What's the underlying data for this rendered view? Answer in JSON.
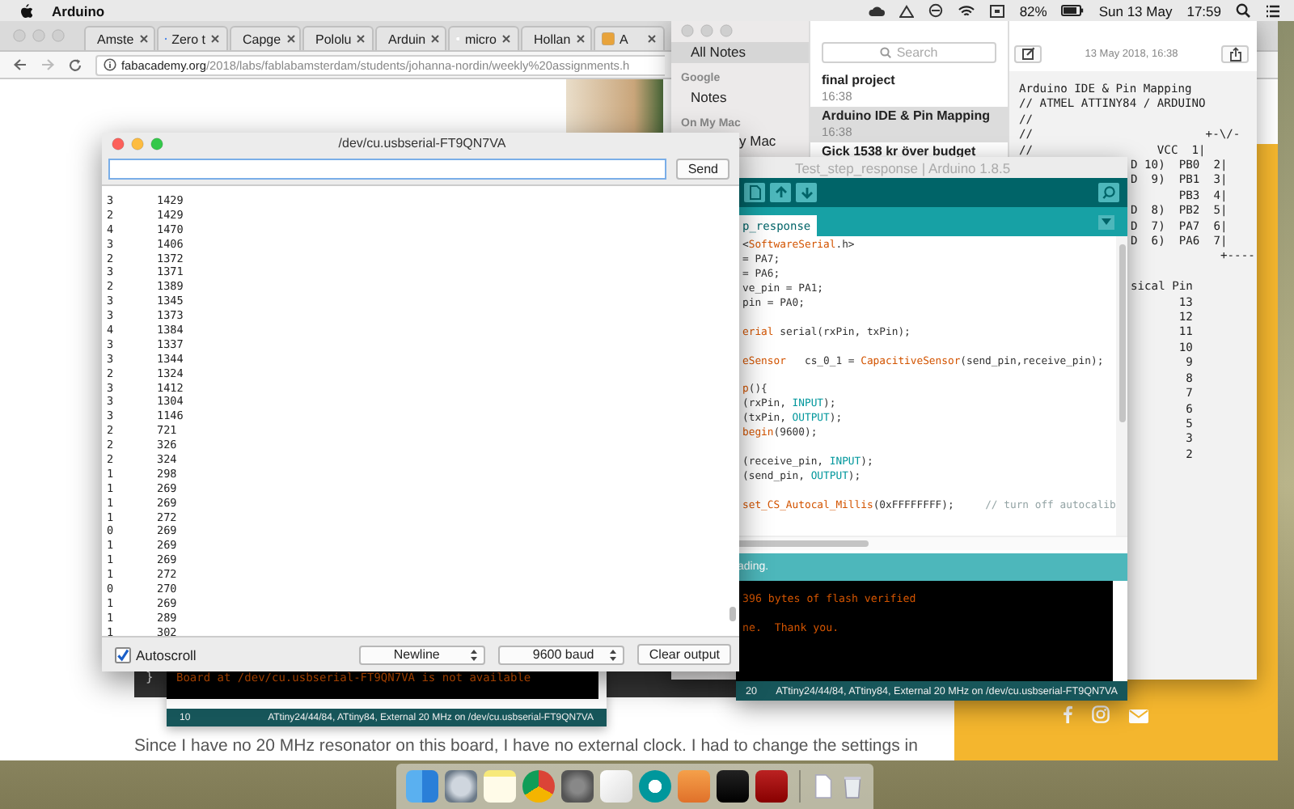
{
  "menu_bar": {
    "app": "Arduino",
    "battery": "82%",
    "date": "Sun 13 May",
    "time": "17:59"
  },
  "browser": {
    "tabs": [
      "Amste",
      "Zero t",
      "Capge",
      "Pololu",
      "Arduin",
      "micro",
      "Hollan",
      "A"
    ],
    "url_host": "fabacademy.org",
    "url_path": "/2018/labs/fablabamsterdam/students/johanna-nordin/weekly%20assignments.h",
    "page": {
      "code_brace": "}",
      "paragraph": "Since I have no 20 MHz resonator on this board, I have no external clock. I had to change the settings in"
    }
  },
  "background_ide": {
    "console": "Board at /dev/cu.usbserial-FT9QN7VA is not available",
    "line_number": "10",
    "board": "ATtiny24/44/84, ATtiny84, External 20 MHz on /dev/cu.usbserial-FT9QN7VA"
  },
  "notes": {
    "sidebar": [
      {
        "kind": "item",
        "label": "All Notes",
        "selected": true
      },
      {
        "kind": "header",
        "label": "Google"
      },
      {
        "kind": "item",
        "label": "Notes",
        "selected": false
      },
      {
        "kind": "header",
        "label": "On My Mac"
      },
      {
        "kind": "cut_item",
        "label": "y Mac",
        "selected": false
      }
    ],
    "search": {
      "placeholder": "Search"
    },
    "list": [
      {
        "title": "final project",
        "time": "16:38",
        "selected": false
      },
      {
        "title": "Arduino IDE & Pin Mapping",
        "time": "16:38",
        "selected": true
      },
      {
        "title": "Gick 1538 kr över budget",
        "selected": false
      }
    ],
    "date": "13 May 2018, 16:38",
    "body_top": [
      "Arduino IDE & Pin Mapping",
      "// ATMEL ATTINY84 / ARDUINO",
      "//",
      "//                         +-\\/-",
      "//                  VCC  1|"
    ],
    "body_right_blocks": [
      [
        "D 10)  PB0  2|",
        "D  9)  PB1  3|",
        "       PB3  4|",
        "D  8)  PB2  5|",
        "D  7)  PA7  6|",
        "D  6)  PA6  7|",
        "             +----"
      ],
      [
        "sical Pin",
        "       13",
        "       12",
        "       11",
        "       10",
        "        9",
        "        8",
        "        7",
        "        6",
        "        5",
        "        3",
        "        2"
      ]
    ]
  },
  "ide": {
    "title": "Test_step_response | Arduino 1.8.5",
    "tab": "p_response",
    "code_blocks": [
      [
        [
          {
            "kind": "plain",
            "text": "<"
          },
          {
            "kind": "type",
            "text": "SoftwareSerial"
          },
          {
            "kind": "plain",
            "text": ".h>"
          }
        ],
        [
          {
            "kind": "plain",
            "text": "= PA7;"
          }
        ],
        [
          {
            "kind": "plain",
            "text": "= PA6;"
          }
        ],
        [
          {
            "kind": "plain",
            "text": "ve_pin = PA1;"
          }
        ],
        [
          {
            "kind": "plain",
            "text": "pin = PA0;"
          }
        ]
      ],
      [
        [
          {
            "kind": "type",
            "text": "erial"
          },
          {
            "kind": "plain",
            "text": " serial(rxPin, txPin);"
          }
        ]
      ],
      [
        [
          {
            "kind": "type",
            "text": "eSensor"
          },
          {
            "kind": "plain",
            "text": "   cs_0_1 = "
          },
          {
            "kind": "type",
            "text": "CapacitiveSensor"
          },
          {
            "kind": "plain",
            "text": "(send_pin,receive_pin);"
          }
        ]
      ],
      [
        [
          {
            "kind": "function",
            "text": "p"
          },
          {
            "kind": "plain",
            "text": "(){"
          }
        ],
        [
          {
            "kind": "plain",
            "text": "(rxPin, "
          },
          {
            "kind": "constant",
            "text": "INPUT"
          },
          {
            "kind": "plain",
            "text": ");"
          }
        ],
        [
          {
            "kind": "plain",
            "text": "(txPin, "
          },
          {
            "kind": "constant",
            "text": "OUTPUT"
          },
          {
            "kind": "plain",
            "text": ");"
          }
        ],
        [
          {
            "kind": "function",
            "text": "begin"
          },
          {
            "kind": "plain",
            "text": "(9600);"
          }
        ]
      ],
      [
        [
          {
            "kind": "plain",
            "text": "(receive_pin, "
          },
          {
            "kind": "constant",
            "text": "INPUT"
          },
          {
            "kind": "plain",
            "text": ");"
          }
        ],
        [
          {
            "kind": "plain",
            "text": "(send_pin, "
          },
          {
            "kind": "constant",
            "text": "OUTPUT"
          },
          {
            "kind": "plain",
            "text": ");"
          }
        ]
      ],
      [
        [
          {
            "kind": "function",
            "text": "set_CS_Autocal_Millis"
          },
          {
            "kind": "plain",
            "text": "(0xFFFFFFFF);"
          },
          {
            "kind": "comment",
            "text": "     // turn off autocalib"
          }
        ]
      ]
    ],
    "status": "ading.",
    "console_blocks": [
      [
        "396 bytes of flash verified"
      ],
      [
        "ne.  Thank you."
      ]
    ],
    "line_number": "20",
    "board": "ATtiny24/44/84, ATtiny84, External 20 MHz on /dev/cu.usbserial-FT9QN7VA"
  },
  "serial": {
    "title": "/dev/cu.usbserial-FT9QN7VA",
    "send": "Send",
    "rows": [
      [
        "3",
        "1429"
      ],
      [
        "2",
        "1429"
      ],
      [
        "4",
        "1470"
      ],
      [
        "3",
        "1406"
      ],
      [
        "2",
        "1372"
      ],
      [
        "3",
        "1371"
      ],
      [
        "2",
        "1389"
      ],
      [
        "3",
        "1345"
      ],
      [
        "3",
        "1373"
      ],
      [
        "4",
        "1384"
      ],
      [
        "3",
        "1337"
      ],
      [
        "3",
        "1344"
      ],
      [
        "2",
        "1324"
      ],
      [
        "3",
        "1412"
      ],
      [
        "3",
        "1304"
      ],
      [
        "3",
        "1146"
      ],
      [
        "2",
        "721"
      ],
      [
        "2",
        "326"
      ],
      [
        "2",
        "324"
      ],
      [
        "1",
        "298"
      ],
      [
        "1",
        "269"
      ],
      [
        "1",
        "269"
      ],
      [
        "1",
        "272"
      ],
      [
        "0",
        "269"
      ],
      [
        "1",
        "269"
      ],
      [
        "1",
        "269"
      ],
      [
        "1",
        "272"
      ],
      [
        "0",
        "270"
      ],
      [
        "1",
        "269"
      ],
      [
        "1",
        "289"
      ],
      [
        "1",
        "302"
      ]
    ],
    "autoscroll": {
      "label": "Autoscroll",
      "checked": true
    },
    "line_ending": "Newline",
    "baud": "9600 baud",
    "clear": "Clear output"
  }
}
